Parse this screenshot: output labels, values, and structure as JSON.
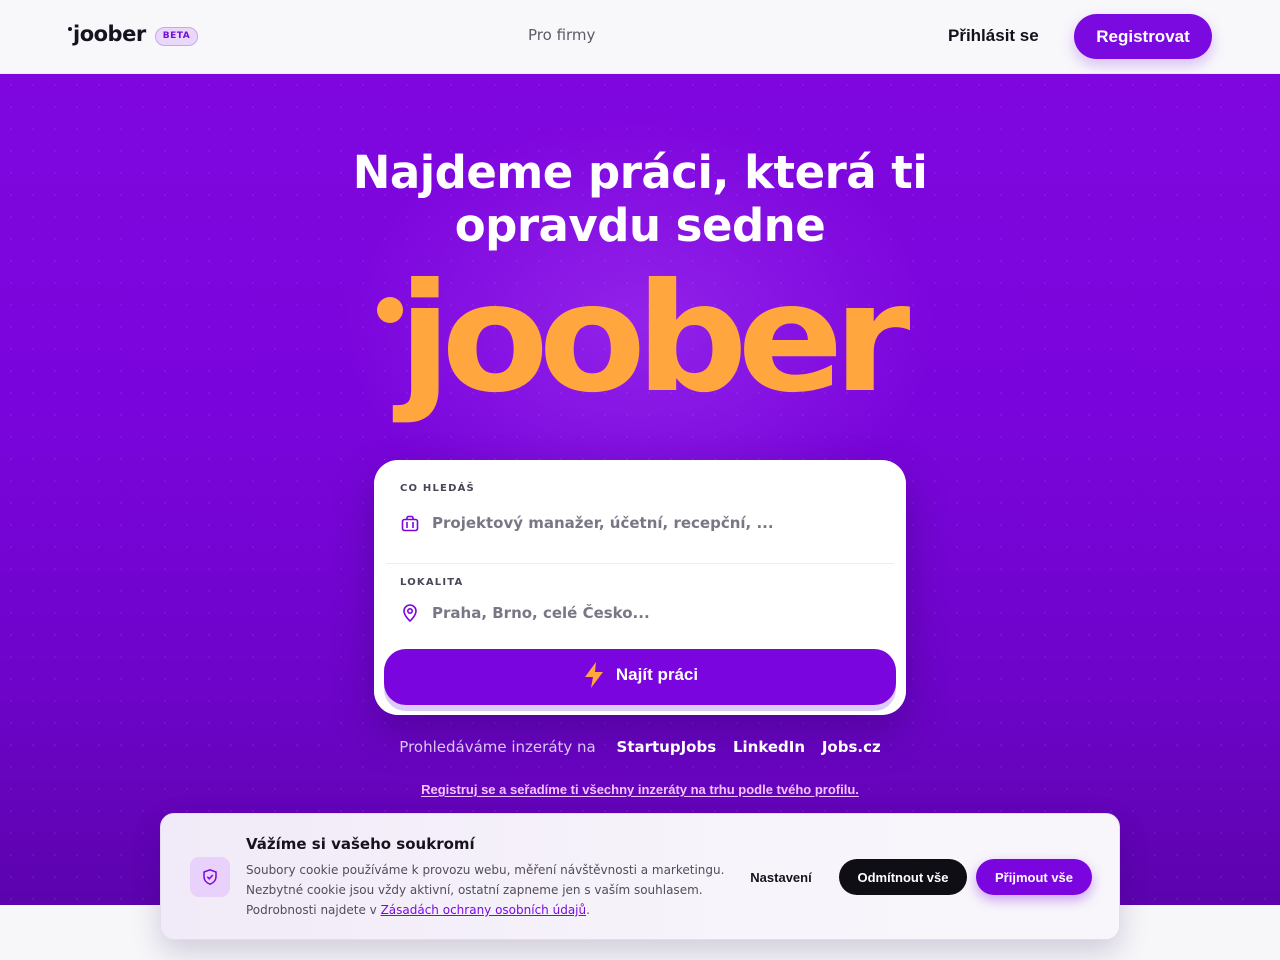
{
  "header": {
    "logo_text": "joober",
    "beta_badge": "BETA",
    "nav_firms": "Pro firmy",
    "login_label": "Přihlásit se",
    "register_label": "Registrovat"
  },
  "hero": {
    "headline_line1": "Najdeme práci, která ti",
    "headline_line2": "opravdu sedne",
    "brand_word": "joober",
    "brand_color": "#ffa63f"
  },
  "search": {
    "what_label": "CO HLEDÁŠ",
    "what_placeholder": "Projektový manažer, účetní, recepční, ...",
    "where_label": "LOKALITA",
    "where_placeholder": "Praha, Brno, celé Česko...",
    "submit_label": "Najít práci"
  },
  "sources": {
    "intro": "Prohledáváme inzeráty na",
    "items": [
      "StartupJobs",
      "LinkedIn",
      "Jobs.cz"
    ]
  },
  "cta_link": "Registruj se a seřadíme ti všechny inzeráty na trhu podle tvého profilu.",
  "cookie": {
    "title": "Vážíme si vašeho soukromí",
    "line1": "Soubory cookie používáme k provozu webu, měření návštěvnosti a marketingu.",
    "line2": "Nezbytné cookie jsou vždy aktivní, ostatní zapneme jen s vaším souhlasem.",
    "line3_prefix": "Podrobnosti najdete v ",
    "policy_link": "Zásadách ochrany osobních údajů",
    "line3_suffix": ".",
    "settings_label": "Nastavení",
    "reject_label": "Odmítnout vše",
    "accept_label": "Přijmout vše"
  },
  "colors": {
    "brand_purple": "#7b05de",
    "brand_orange": "#ffa63f",
    "dark": "#0f0e15"
  }
}
